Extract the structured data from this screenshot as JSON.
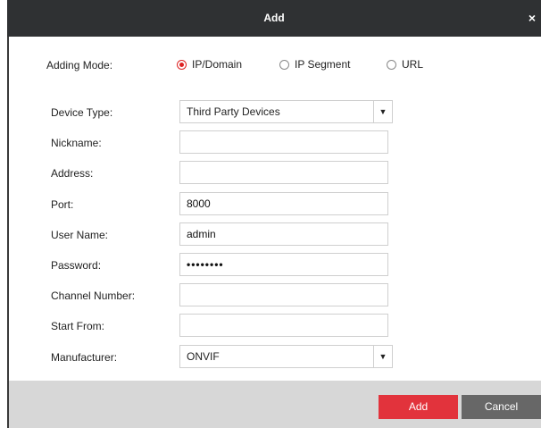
{
  "dialog": {
    "title": "Add",
    "close_glyph": "×"
  },
  "adding_mode": {
    "label": "Adding Mode:",
    "options": [
      {
        "label": "IP/Domain",
        "selected": true
      },
      {
        "label": "IP Segment",
        "selected": false
      },
      {
        "label": "URL",
        "selected": false
      }
    ]
  },
  "form": {
    "device_type": {
      "label": "Device Type:",
      "value": "Third Party Devices"
    },
    "nickname": {
      "label": "Nickname:",
      "value": ""
    },
    "address": {
      "label": "Address:",
      "value": ""
    },
    "port": {
      "label": "Port:",
      "value": "8000"
    },
    "user_name": {
      "label": "User Name:",
      "value": "admin"
    },
    "password": {
      "label": "Password:",
      "value": "••••••••"
    },
    "channel_number": {
      "label": "Channel Number:",
      "value": ""
    },
    "start_from": {
      "label": "Start From:",
      "value": ""
    },
    "manufacturer": {
      "label": "Manufacturer:",
      "value": "ONVIF"
    }
  },
  "buttons": {
    "add": "Add",
    "cancel": "Cancel"
  },
  "colors": {
    "titlebar": "#2f3133",
    "accent": "#e2333c",
    "cancel": "#676767",
    "footer": "#d7d7d7"
  }
}
